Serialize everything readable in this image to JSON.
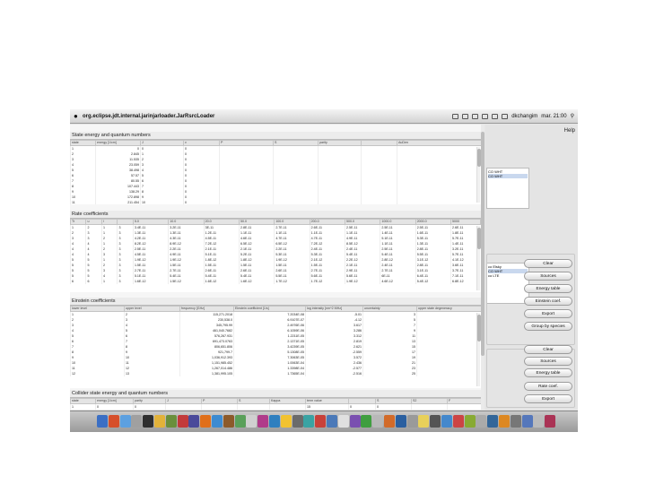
{
  "menubar": {
    "title": "org.eclipse.jdt.internal.jarinjarloader.JarRsrcLoader",
    "user": "dkchangim",
    "clock": "mar. 21:00"
  },
  "state_section": {
    "title": "State energy and quantum numbers",
    "headers": [
      "state",
      "energy [1/cm]",
      "J",
      "v",
      "P",
      "S",
      "parity",
      "",
      "AuDen"
    ],
    "rows": [
      [
        "1",
        "0",
        "0",
        "0"
      ],
      [
        "2",
        "2.845",
        "1",
        "0"
      ],
      [
        "3",
        "11.535",
        "2",
        "0"
      ],
      [
        "4",
        "23.059",
        "3",
        "0"
      ],
      [
        "5",
        "38.498",
        "4",
        "0"
      ],
      [
        "6",
        "57.57",
        "5",
        "0"
      ],
      [
        "7",
        "80.55",
        "6",
        "0"
      ],
      [
        "8",
        "107.443",
        "7",
        "0"
      ],
      [
        "9",
        "138.29",
        "8",
        "0"
      ],
      [
        "10",
        "172.898",
        "9",
        "0"
      ],
      [
        "11",
        "211.454",
        "10",
        "0"
      ]
    ]
  },
  "rate_section": {
    "title": "Rate coefficients",
    "headers": [
      "Tr",
      "u",
      "l",
      "",
      "5.0",
      "10.0",
      "20.0",
      "50.0",
      "100.0",
      "200.0",
      "500.0",
      "1000.0",
      "2000.0",
      "5000"
    ],
    "rows": [
      [
        "1",
        "2",
        "1",
        "3",
        "3.4E-11",
        "3.2E-11",
        "3E-11",
        "2.8E-11",
        "2.7E-11",
        "2.6E-11",
        "2.5E-11",
        "2.5E-11",
        "2.5E-11",
        "2.6E-11"
      ],
      [
        "2",
        "3",
        "1",
        "3",
        "1.3E-11",
        "1.3E-11",
        "1.2E-11",
        "1.1E-11",
        "1.1E-11",
        "1.1E-11",
        "1.1E-11",
        "1.4E-11",
        "1.6E-11",
        "1.8E-11"
      ],
      [
        "3",
        "3",
        "2",
        "3",
        "4.2E-11",
        "4.3E-11",
        "4.5E-11",
        "4.6E-11",
        "4.7E-11",
        "4.7E-11",
        "4.9E-11",
        "5.1E-11",
        "5.3E-11",
        "5.7E-11"
      ],
      [
        "4",
        "4",
        "1",
        "3",
        "8.2E-12",
        "8.9E-12",
        "7.2E-12",
        "6.5E-12",
        "6.5E-12",
        "7.2E-12",
        "8.5E-12",
        "1.1E-11",
        "1.3E-11",
        "1.4E-11"
      ],
      [
        "4",
        "4",
        "2",
        "3",
        "2.5E-11",
        "2.2E-11",
        "2.1E-11",
        "2.1E-11",
        "2.2E-11",
        "2.4E-11",
        "2.4E-11",
        "2.5E-11",
        "2.8E-11",
        "3.2E-11"
      ],
      [
        "4",
        "4",
        "3",
        "3",
        "4.5E-11",
        "4.9E-11",
        "5.1E-11",
        "5.2E-11",
        "5.3E-11",
        "5.3E-11",
        "5.4E-11",
        "5.4E-11",
        "5.5E-11",
        "5.7E-11"
      ],
      [
        "5",
        "5",
        "1",
        "3",
        "1.9E-12",
        "1.9E-12",
        "1.8E-12",
        "1.8E-12",
        "1.9E-12",
        "2.1E-12",
        "2.2E-12",
        "2.8E-12",
        "3.1E-12",
        "4.1E-12"
      ],
      [
        "5",
        "5",
        "2",
        "3",
        "1.5E-11",
        "1.5E-11",
        "1.5E-11",
        "1.5E-11",
        "1.5E-11",
        "1.5E-11",
        "2.1E-11",
        "2.4E-11",
        "2.8E-11",
        "3.6E-11"
      ],
      [
        "5",
        "5",
        "3",
        "3",
        "2.7E-11",
        "2.7E-11",
        "2.6E-11",
        "2.6E-11",
        "2.6E-11",
        "2.7E-11",
        "2.9E-11",
        "2.7E-11",
        "3.1E-11",
        "3.7E-11"
      ],
      [
        "5",
        "5",
        "4",
        "3",
        "5.1E-11",
        "5.4E-11",
        "5.4E-11",
        "5.4E-11",
        "5.5E-11",
        "5.6E-11",
        "5.6E-11",
        "6E-11",
        "6.4E-11",
        "7.1E-11"
      ],
      [
        "6",
        "6",
        "1",
        "3",
        "1.6E-12",
        "1.5E-12",
        "1.6E-12",
        "1.6E-12",
        "1.7E-12",
        "1.7E-12",
        "1.9E-12",
        "4.6E-12",
        "5.4E-12",
        "6.8E-12"
      ]
    ]
  },
  "einstein_section": {
    "title": "Einstein coefficients",
    "headers": [
      "lower level",
      "upper level",
      "frequency [GHz]",
      "Einstein coefficient [1/s]",
      "log intensity [nm^2 MHz]",
      "uncertainty",
      "upper state degeneracy"
    ],
    "rows": [
      [
        "1",
        "2",
        "115,271.2018",
        "7.2034E-08",
        "-5.01",
        "3"
      ],
      [
        "2",
        "3",
        "230,538.0",
        "6.9107E-07",
        "-4.12",
        "5"
      ],
      [
        "3",
        "4",
        "345,795.99",
        "2.4976E-06",
        "3.617",
        "7"
      ],
      [
        "4",
        "5",
        "461,040.7682",
        "6.1059E-06",
        "3.286",
        "9"
      ],
      [
        "5",
        "6",
        "576,267.931",
        "1.2211E-05",
        "3.312",
        "11"
      ],
      [
        "6",
        "7",
        "691,473.0763",
        "2.1371E-05",
        "2.819",
        "13"
      ],
      [
        "7",
        "8",
        "806,651.806",
        "3.4239E-05",
        "2.621",
        "15"
      ],
      [
        "8",
        "9",
        "921,799.7",
        "5.1308E-05",
        "-2.559",
        "17"
      ],
      [
        "9",
        "10",
        "1,036,912.393",
        "7.3063E-05",
        "3.572",
        "19"
      ],
      [
        "10",
        "11",
        "1,151,985.452",
        "1.0063E-04",
        "2.436",
        "21"
      ],
      [
        "11",
        "12",
        "1,267,014.486",
        "1.3398E-04",
        "-2.577",
        "23"
      ],
      [
        "12",
        "13",
        "1,381,995.105",
        "1.7365E-04",
        "-2.516",
        "25"
      ]
    ]
  },
  "collider_section": {
    "title": "Collider state energy and quantum numbers",
    "headers": [
      "state",
      "energy [1/cm]",
      "parity",
      "J",
      "P",
      "S",
      "Kappa",
      "term value",
      "",
      "S",
      "S2",
      "F"
    ],
    "rows": [
      [
        "1",
        "0",
        "0",
        "",
        "",
        "",
        "",
        "15",
        "0",
        "0"
      ]
    ]
  },
  "right_panel": {
    "help": "Help",
    "list_top": [
      "CO WHT",
      "CO WHT"
    ],
    "list_bottom": [
      "co Elsky",
      "CO WHT",
      "co LTE"
    ],
    "group1_buttons": [
      "Clear",
      "Sources",
      "Energy table",
      "Einstein coef.",
      "Export",
      "Group by species"
    ],
    "group2_buttons": [
      "Clear",
      "Sources",
      "Energy table",
      "Rate coef.",
      "Export"
    ]
  },
  "colors": {
    "dock_icons": [
      "#3b6fc4",
      "#d64f2a",
      "#5ca0e0",
      "#a0a0a0",
      "#2f2f2f",
      "#e2b23a",
      "#6a8f3c",
      "#c23a3a",
      "#4a4a9a",
      "#e06f1a",
      "#3d8bd1",
      "#8c5a2a",
      "#5aa05a",
      "#d0d0d0",
      "#b03b8a",
      "#2e7fbf",
      "#f2c230",
      "#6b6b6b",
      "#3aa3a3",
      "#c8413a",
      "#4b79b8",
      "#e0e0e0",
      "#7a4fb0",
      "#3f9e3f",
      "#b8b8b8",
      "#d26b2a",
      "#2a5fa0",
      "#9a9a9a",
      "#e8d05a",
      "#555555",
      "#4488cc",
      "#cc4444",
      "#88aa33",
      "#aaaaaa",
      "#336699",
      "#dd8822",
      "#777777",
      "#5577bb",
      "#bbbbbb",
      "#aa3355"
    ]
  }
}
